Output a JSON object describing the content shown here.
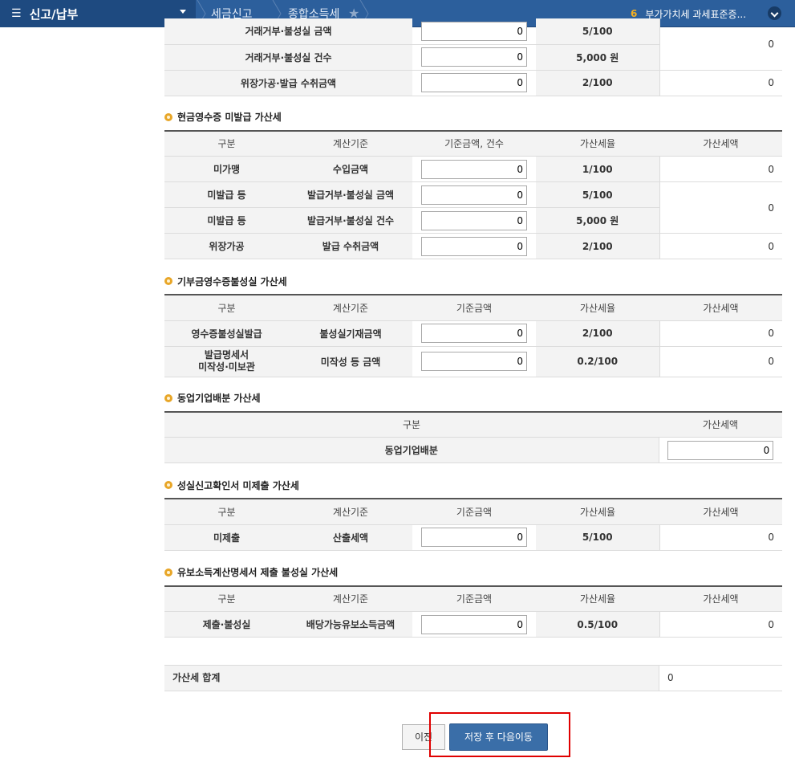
{
  "topbar": {
    "menu_icon": "☰",
    "menu_title": "신고/납부",
    "crumbs": [
      "세금신고",
      "종합소득세"
    ],
    "notice_number": "6",
    "notice_text": "부가가치세 과세표준증..."
  },
  "section0": {
    "rows": [
      {
        "label": "거래거부·불성실 금액",
        "value": "0",
        "rate": "5/100"
      },
      {
        "label": "거래거부·불성실 건수",
        "value": "0",
        "rate": "5,000 원"
      },
      {
        "label": "위장가공·발급 수취금액",
        "value": "0",
        "rate": "2/100",
        "amount": "0"
      }
    ],
    "merged_amount": "0"
  },
  "section1": {
    "title": "현금영수증 미발급 가산세",
    "headers": [
      "구분",
      "계산기준",
      "기준금액, 건수",
      "가산세율",
      "가산세액"
    ],
    "rows": [
      {
        "cat": "미가맹",
        "basis": "수입금액",
        "value": "0",
        "rate": "1/100",
        "amount": "0"
      },
      {
        "cat": "미발급 등",
        "basis": "발급거부·불성실 금액",
        "value": "0",
        "rate": "5/100"
      },
      {
        "cat": "미발급 등",
        "basis": "발급거부·불성실 건수",
        "value": "0",
        "rate": "5,000 원"
      },
      {
        "cat": "위장가공",
        "basis": "발급 수취금액",
        "value": "0",
        "rate": "2/100",
        "amount": "0"
      }
    ],
    "merged_amount": "0"
  },
  "section2": {
    "title": "기부금영수증불성실 가산세",
    "headers": [
      "구분",
      "계산기준",
      "기준금액",
      "가산세율",
      "가산세액"
    ],
    "rows": [
      {
        "cat": "영수증불성실발급",
        "basis": "불성실기재금액",
        "value": "0",
        "rate": "2/100",
        "amount": "0"
      },
      {
        "cat_line1": "발급명세서",
        "cat_line2": "미작성·미보관",
        "basis": "미작성 등 금액",
        "value": "0",
        "rate": "0.2/100",
        "amount": "0"
      }
    ]
  },
  "section3": {
    "title": "동업기업배분 가산세",
    "headers": [
      "구분",
      "가산세액"
    ],
    "row": {
      "cat": "동업기업배분",
      "value": "0"
    }
  },
  "section4": {
    "title": "성실신고확인서 미제출 가산세",
    "headers": [
      "구분",
      "계산기준",
      "기준금액",
      "가산세율",
      "가산세액"
    ],
    "row": {
      "cat": "미제출",
      "basis": "산출세액",
      "value": "0",
      "rate": "5/100",
      "amount": "0"
    }
  },
  "section5": {
    "title": "유보소득계산명세서 제출 불성실 가산세",
    "headers": [
      "구분",
      "계산기준",
      "기준금액",
      "가산세율",
      "가산세액"
    ],
    "row": {
      "cat": "제출·불성실",
      "basis": "배당가능유보소득금액",
      "value": "0",
      "rate": "0.5/100",
      "amount": "0"
    }
  },
  "total": {
    "label": "가산세 합계",
    "value": "0"
  },
  "buttons": {
    "prev": "이전",
    "next": "저장 후 다음이동"
  },
  "colors": {
    "topbar": "#2c5f9c",
    "accent": "#e8a628",
    "highlight": "#e00000",
    "primary_button": "#3a6ea8"
  }
}
